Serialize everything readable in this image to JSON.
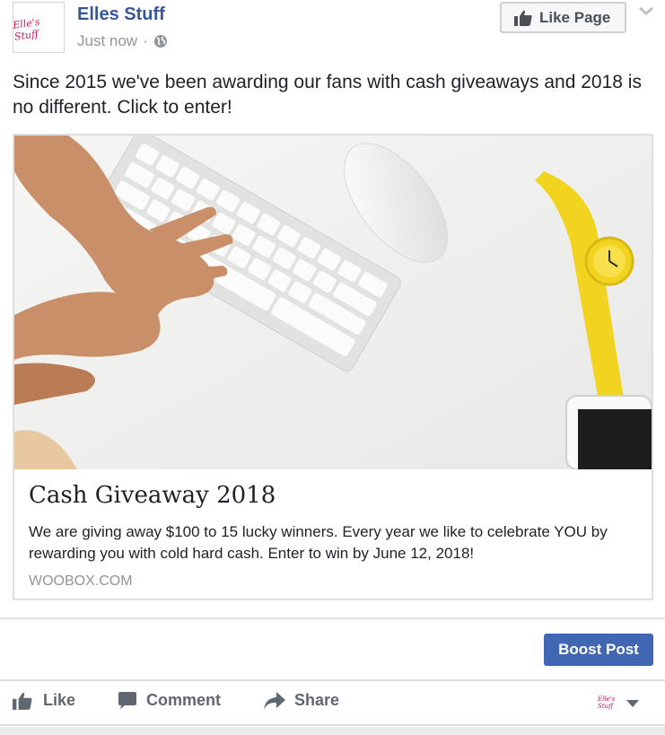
{
  "post": {
    "page_name": "Elles Stuff",
    "avatar_text": "Elle's Stuff",
    "timestamp": "Just now",
    "separator": "·",
    "privacy_icon": "globe-icon",
    "like_page_label": "Like Page",
    "options_icon": "chevron-down-icon",
    "text": "Since 2015 we've been awarding our fans with cash giveaways and 2018 is no different. Click to enter!"
  },
  "link_card": {
    "title": "Cash Giveaway 2018",
    "description": "We are giving away $100 to 15 lucky winners. Every year we like to celebrate YOU by rewarding you with cold hard cash. Enter to win by June 12, 2018!",
    "domain": "WOOBOX.COM"
  },
  "boost_label": "Boost Post",
  "actions": {
    "like": "Like",
    "comment": "Comment",
    "share": "Share"
  },
  "colors": {
    "link": "#365899",
    "boost": "#4267b2",
    "muted": "#90949c",
    "watch": "#f2d31f"
  }
}
